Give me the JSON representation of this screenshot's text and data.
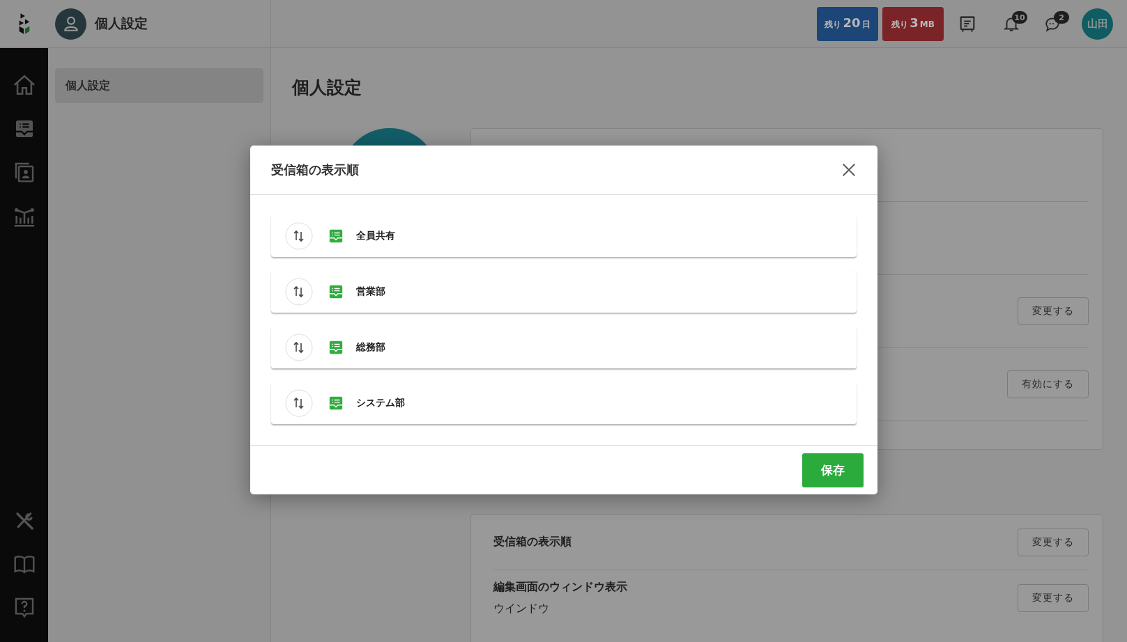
{
  "header": {
    "title": "個人設定"
  },
  "plan_badges": [
    {
      "prefix": "残り",
      "value": "20",
      "unit": "日",
      "color": "#1b4677"
    },
    {
      "prefix": "残り",
      "value": "3",
      "unit": "MB",
      "color": "#7a2427"
    }
  ],
  "notifications": {
    "count": "10"
  },
  "messages": {
    "count": "2"
  },
  "user": {
    "initials": "山田"
  },
  "side_menu": [
    {
      "label": "個人設定",
      "selected": true
    }
  ],
  "page": {
    "title": "個人設定"
  },
  "settings_card_1": {
    "rows": [
      {
        "button": "変更する"
      },
      {
        "button": "有効にする"
      }
    ]
  },
  "settings_card_2": {
    "rows": [
      {
        "label": "受信箱の表示順",
        "button": "変更する"
      },
      {
        "label": "編集画面のウィンドウ表示",
        "value": "ウインドウ",
        "button": "変更する"
      }
    ]
  },
  "dialog": {
    "title": "受信箱の表示順",
    "items": [
      {
        "label": "全員共有"
      },
      {
        "label": "営業部"
      },
      {
        "label": "総務部"
      },
      {
        "label": "システム部"
      }
    ],
    "save_button": "保存"
  }
}
